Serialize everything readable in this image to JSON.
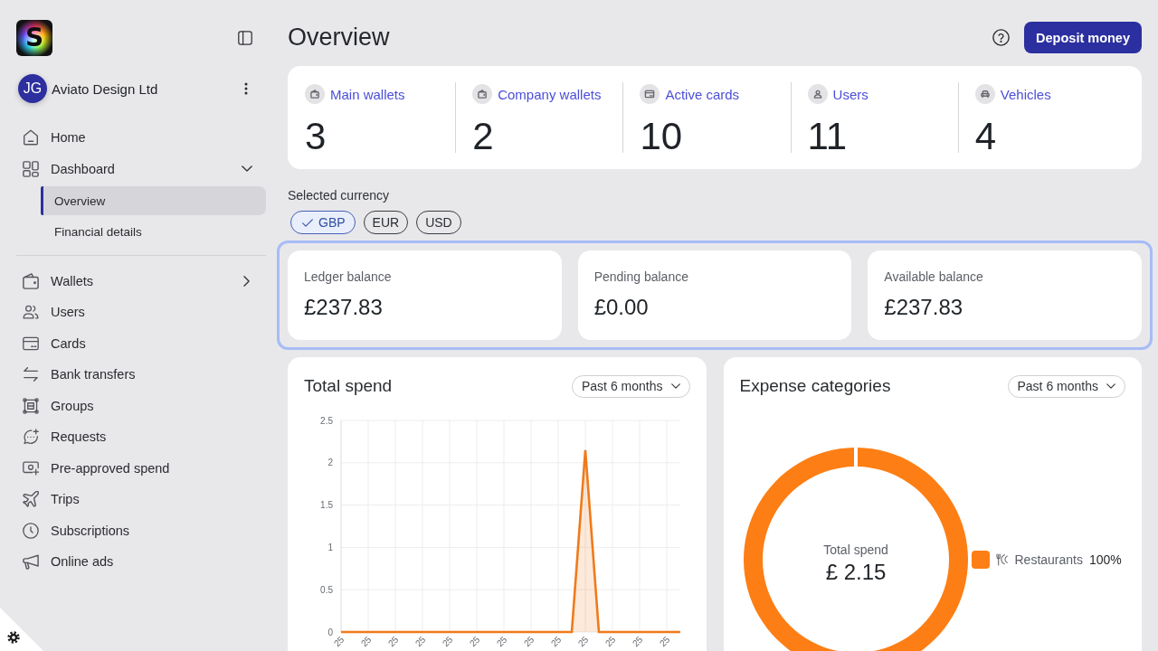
{
  "logo": {
    "letter": "S"
  },
  "org": {
    "initials": "JG",
    "name": "Aviato Design Ltd"
  },
  "nav": [
    {
      "items": [
        {
          "label": "Home",
          "selected": false
        },
        {
          "label": "Dashboard",
          "selected": false,
          "expanded": true,
          "children": [
            {
              "label": "Overview",
              "selected": true
            },
            {
              "label": "Financial details",
              "selected": false
            }
          ]
        }
      ]
    },
    {
      "items": [
        {
          "label": "Wallets",
          "selected": false,
          "expanded": false
        },
        {
          "label": "Users",
          "selected": false
        },
        {
          "label": "Cards",
          "selected": false
        },
        {
          "label": "Bank transfers",
          "selected": false
        },
        {
          "label": "Groups",
          "selected": false
        },
        {
          "label": "Requests",
          "selected": false
        },
        {
          "label": "Pre-approved spend",
          "selected": false
        },
        {
          "label": "Trips",
          "selected": false
        },
        {
          "label": "Subscriptions",
          "selected": false
        },
        {
          "label": "Online ads",
          "selected": false
        }
      ]
    }
  ],
  "page_title": "Overview",
  "deposit_button": "Deposit money",
  "stats": [
    {
      "label": "Main wallets",
      "value": "3"
    },
    {
      "label": "Company wallets",
      "value": "2"
    },
    {
      "label": "Active cards",
      "value": "10"
    },
    {
      "label": "Users",
      "value": "11"
    },
    {
      "label": "Vehicles",
      "value": "4"
    }
  ],
  "currency": {
    "label": "Selected currency",
    "options": [
      {
        "label": "GBP",
        "selected": true
      },
      {
        "label": "EUR",
        "selected": false
      },
      {
        "label": "USD",
        "selected": false
      }
    ]
  },
  "balances": {
    "highlighted": true,
    "cards": [
      {
        "label": "Ledger balance",
        "value": "£237.83"
      },
      {
        "label": "Pending balance",
        "value": "£0.00"
      },
      {
        "label": "Available balance",
        "value": "£237.83"
      }
    ]
  },
  "total_spend": {
    "title": "Total spend",
    "period": "Past 6 months",
    "chart_data": {
      "type": "area",
      "grid": true,
      "categories": [
        "25",
        null,
        "25",
        null,
        "25",
        null,
        "25",
        null,
        "25",
        null,
        "25",
        null,
        "25",
        null,
        "25",
        null,
        "25",
        null,
        "25",
        null,
        "25",
        null,
        "25",
        null,
        "25",
        null
      ],
      "ylim": [
        0,
        2.5
      ],
      "yticks": [
        0,
        0.5,
        1,
        1.5,
        2,
        2.5
      ],
      "series": [
        {
          "color": "#f07a1b",
          "values": [
            0,
            0,
            0,
            0,
            0,
            0,
            0,
            0,
            0,
            0,
            0,
            0,
            0,
            0,
            0,
            0,
            0,
            0,
            2.15,
            0,
            0,
            0,
            0,
            0,
            0,
            0
          ]
        }
      ]
    }
  },
  "expense_categories": {
    "title": "Expense categories",
    "period": "Past 6 months",
    "center": {
      "label": "Total spend",
      "value": "£ 2.15"
    },
    "legend": [
      {
        "share": "100%",
        "color": "#fd7e14"
      }
    ],
    "chart_data": {
      "type": "pie",
      "categories": [
        "Restaurants"
      ],
      "values": [
        100
      ]
    }
  }
}
